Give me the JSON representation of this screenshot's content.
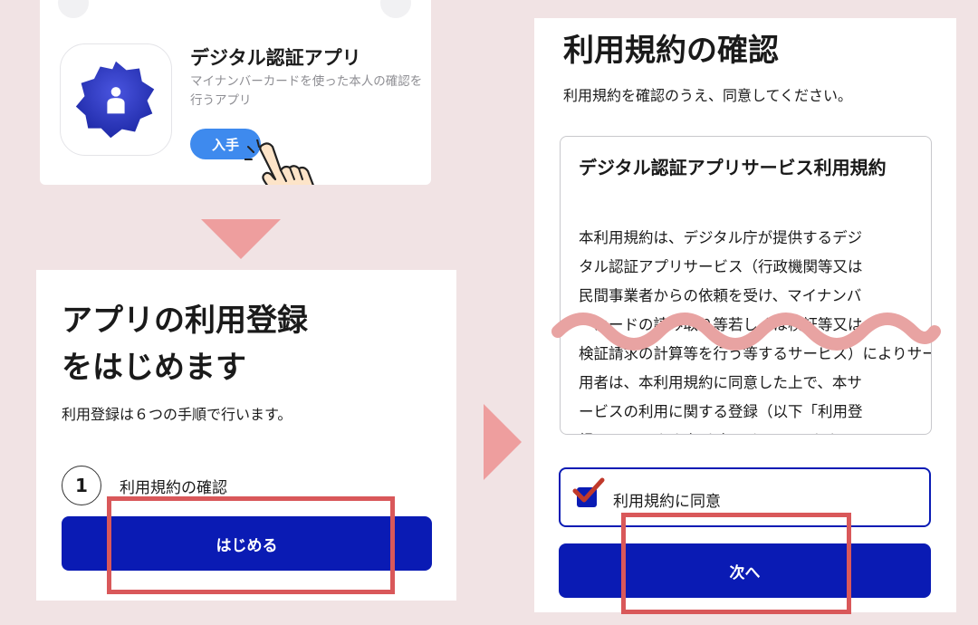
{
  "store": {
    "app_title": "デジタル認証アプリ",
    "app_description": "マイナンバーカードを使った本人の確認を行うアプリ",
    "get_button_label": "入手",
    "icon": "digital-auth-app-icon"
  },
  "register": {
    "heading_line1": "アプリの利用登録",
    "heading_line2": "をはじめます",
    "subtitle": "利用登録は６つの手順で行います。",
    "step_number": "1",
    "step_label": "利用規約の確認",
    "start_button_label": "はじめる"
  },
  "terms": {
    "title": "利用規約の確認",
    "subtitle": "利用規約を確認のうえ、同意してください。",
    "box_title": "デジタル認証アプリサービス利用規約",
    "body_lines": [
      "本利用規約は、デジタル庁が提供するデジ",
      "タル認証アプリサービス（行政機関等又は",
      "民間事業者からの依頼を受け、マイナンバ",
      "ーカードの読み取り等若しくは検証等又は",
      "検証請求の計算等を行う等するサービス）によりサービスの利",
      "用者は、本利用規約に同意した上で、本サ",
      "ービスの利用に関する登録（以下「利用登",
      "録」といいます。）を行うものとします。"
    ],
    "agree_label": "利用規約に同意",
    "next_button_label": "次へ"
  },
  "colors": {
    "background": "#f1e3e4",
    "primary": "#0a1bb4",
    "highlight": "#d9585a",
    "arrow": "#ee9e9e",
    "get_button": "#3e8aee"
  }
}
